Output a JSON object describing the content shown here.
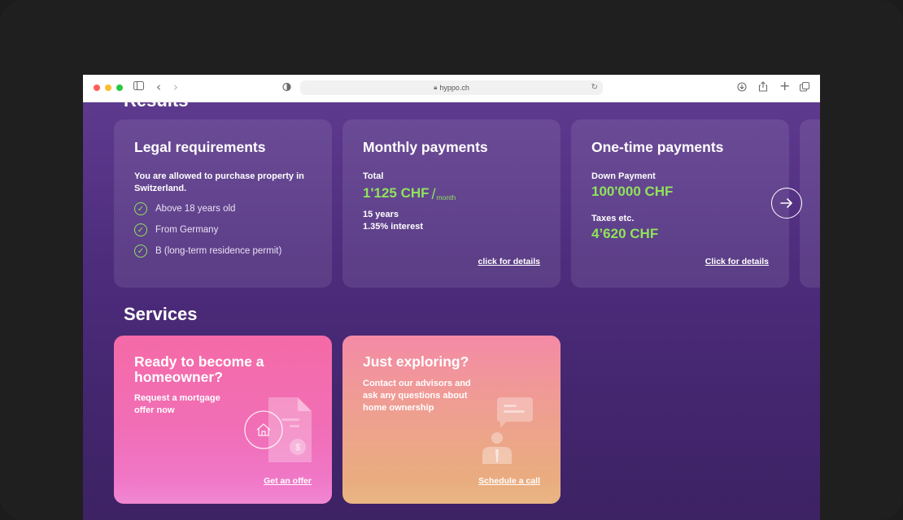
{
  "browser": {
    "url": "hyppo.ch"
  },
  "results": {
    "heading": "Results",
    "cards": [
      {
        "title": "Legal requirements",
        "lead": "You are allowed to purchase property in Switzerland.",
        "checks": [
          "Above 18 years old",
          "From Germany",
          "B (long-term residence permit)"
        ]
      },
      {
        "title": "Monthly payments",
        "total_label": "Total",
        "total_value": "1'125 CHF",
        "per": "month",
        "term": "15 years",
        "interest": "1.35% interest",
        "link": "click for details"
      },
      {
        "title": "One-time payments",
        "down_label": "Down Payment",
        "down_value": "100'000 CHF",
        "taxes_label": "Taxes etc.",
        "taxes_value": "4’620 CHF",
        "link": "Click for details"
      }
    ]
  },
  "services": {
    "heading": "Services",
    "cards": [
      {
        "title": "Ready to become a homeowner?",
        "desc": "Request a mortgage offer now",
        "cta": "Get an offer"
      },
      {
        "title": "Just exploring?",
        "desc": "Contact our advisors and ask any questions about home ownership",
        "cta": "Schedule a call"
      }
    ]
  },
  "colors": {
    "accent_green": "#8fe35b",
    "pink_card": "#f56aa7",
    "peach_card": "#eda38c",
    "background": "#4d2c7c"
  }
}
